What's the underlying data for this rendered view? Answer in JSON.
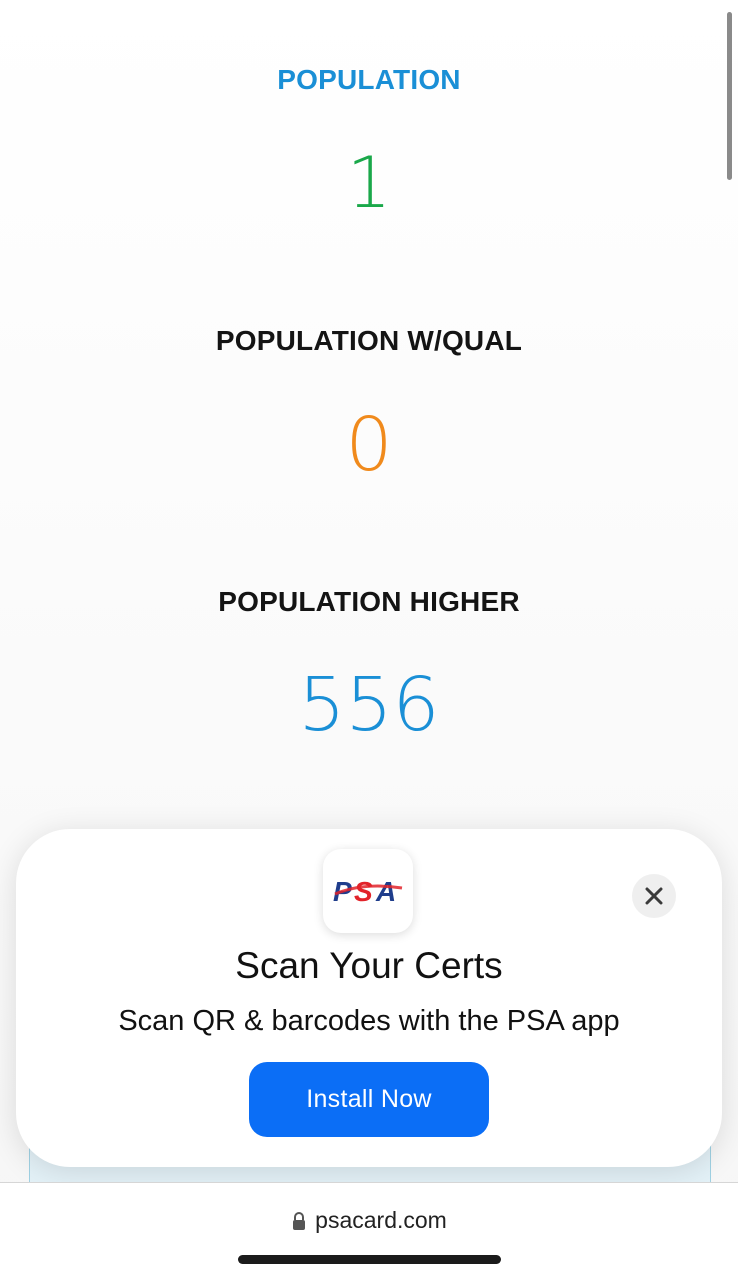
{
  "stats": [
    {
      "title": "POPULATION",
      "value": "1"
    },
    {
      "title": "POPULATION W/QUAL",
      "value": "0"
    },
    {
      "title": "POPULATION HIGHER",
      "value": "556"
    }
  ],
  "banner": {
    "app_logo_text": "PSA",
    "title": "Scan Your Certs",
    "subtitle": "Scan QR & barcodes with the PSA app",
    "install_label": "Install Now",
    "close_icon": "close-icon"
  },
  "browser": {
    "url": "psacard.com",
    "lock_icon": "lock-icon"
  },
  "colors": {
    "accent_blue": "#1a8fd6",
    "value_green": "#1aa84a",
    "value_orange": "#f08a1c",
    "button_blue": "#0b6ef6",
    "psa_red": "#e2232a",
    "psa_navy": "#1f3d8c"
  }
}
